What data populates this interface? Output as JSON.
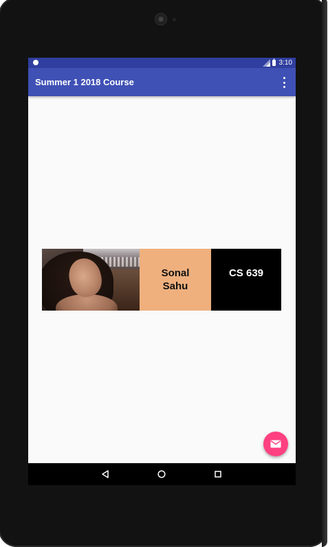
{
  "status_bar": {
    "time": "3:10"
  },
  "app_bar": {
    "title": "Summer 1 2018 Course"
  },
  "card": {
    "name": "Sonal Sahu",
    "course": "CS 639",
    "name_bg_color": "#efb07e",
    "course_bg_color": "#000000"
  },
  "fab": {
    "icon": "mail-icon",
    "color": "#ff4081"
  },
  "nav_bar": {
    "back_icon": "back-triangle-icon",
    "home_icon": "home-circle-icon",
    "recents_icon": "recents-square-icon"
  },
  "colors": {
    "primary": "#3f51b5",
    "primary_dark": "#303f9f",
    "accent": "#ff4081"
  }
}
